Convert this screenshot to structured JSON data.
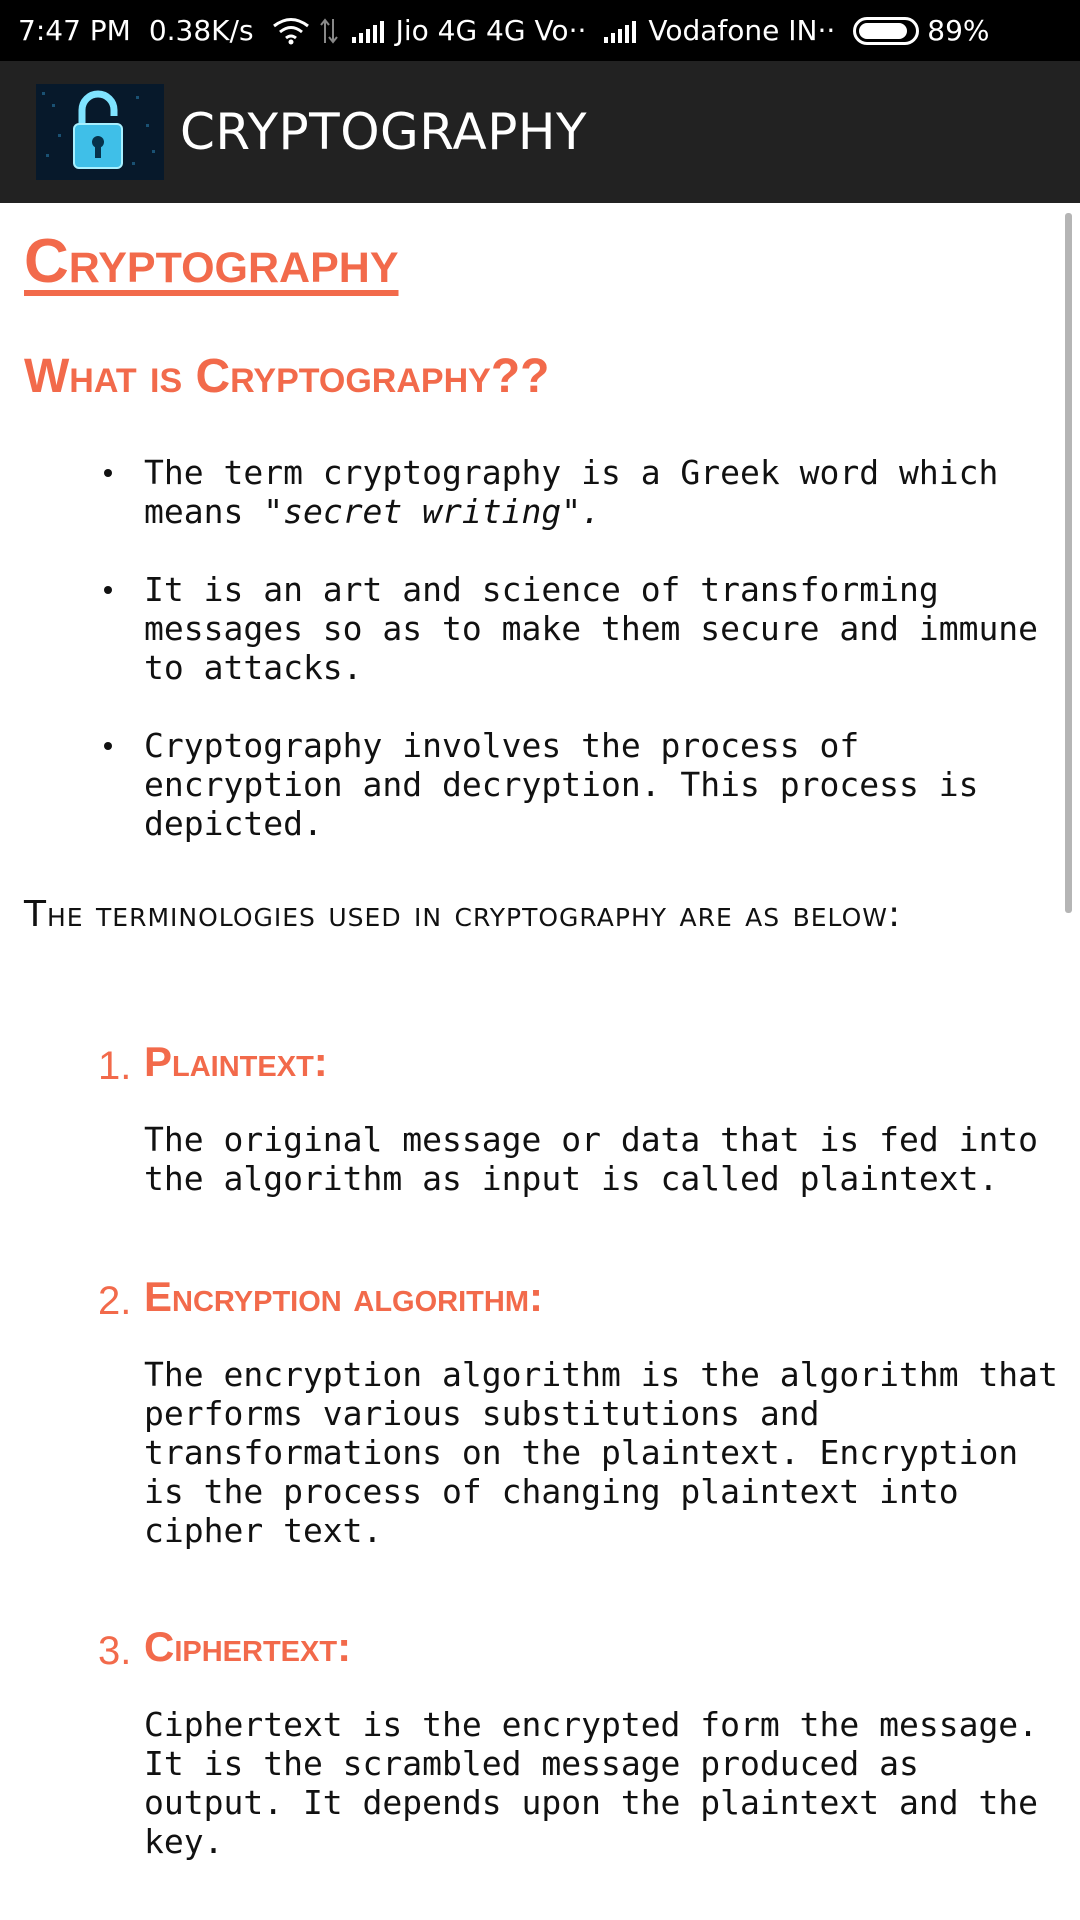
{
  "status_bar": {
    "time": "7:47 PM",
    "speed": "0.38K/s",
    "carrier1": "Jio 4G 4G Vo··",
    "carrier2": "Vodafone IN··",
    "battery": "89%",
    "battery_level": 0.89
  },
  "app_bar": {
    "title": "CRYPTOGRAPHY",
    "logo_icon": "padlock-icon"
  },
  "content": {
    "page_title": "Cryptography",
    "section_heading": "What is Cryptography??",
    "bullets": [
      {
        "text_before": "The term cryptography is a Greek word which means ",
        "text_em": "\"secret writing\".",
        "text_after": ""
      },
      {
        "text_before": "It is an art and science of transforming messages so as to make them secure and immune to attacks.",
        "text_em": "",
        "text_after": ""
      },
      {
        "text_before": "Cryptography involves the process of encryption and decryption. This process is depicted.",
        "text_em": "",
        "text_after": ""
      }
    ],
    "terms_intro": "The terminologies used in cryptography are as below:",
    "terms": [
      {
        "number": "1.",
        "title": "Plaintext:",
        "description": "The original message or data that is fed into the algorithm as input is called plaintext."
      },
      {
        "number": "2.",
        "title": "Encryption algorithm:",
        "description": "The encryption algorithm is the algorithm that performs various substitutions and transformations on the plaintext. Encryption is the process of changing plaintext into cipher text."
      },
      {
        "number": "3.",
        "title": "Ciphertext:",
        "description": "Ciphertext is the encrypted form the message. It is the scrambled message produced as output. It depends upon the plaintext and the key."
      }
    ]
  },
  "colors": {
    "accent": "#f26a4b",
    "app_bar": "#222222",
    "status_bar": "#000000"
  }
}
